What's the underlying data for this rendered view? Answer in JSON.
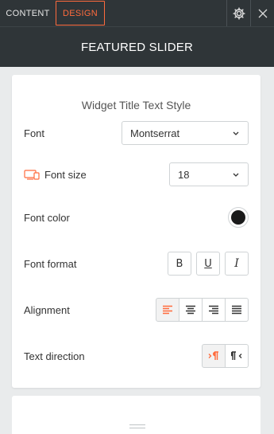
{
  "tabs": {
    "content": "CONTENT",
    "design": "DESIGN"
  },
  "header": {
    "title": "FEATURED SLIDER"
  },
  "section": {
    "title": "Widget Title Text Style"
  },
  "font": {
    "label": "Font",
    "value": "Montserrat"
  },
  "font_size": {
    "label": "Font size",
    "value": "18",
    "device_icon": "desktop-mobile-icon"
  },
  "font_color": {
    "label": "Font color",
    "color": "#1a1a1a"
  },
  "font_format": {
    "label": "Font format",
    "buttons": [
      "B",
      "U",
      "I"
    ]
  },
  "alignment": {
    "label": "Alignment",
    "options": [
      "left",
      "center",
      "right",
      "justify"
    ],
    "active": "left"
  },
  "text_direction": {
    "label": "Text direction",
    "options": [
      "ltr",
      "rtl"
    ],
    "active": "ltr"
  },
  "colors": {
    "accent": "#ff6b3d",
    "dark_bar": "#2f3538"
  }
}
